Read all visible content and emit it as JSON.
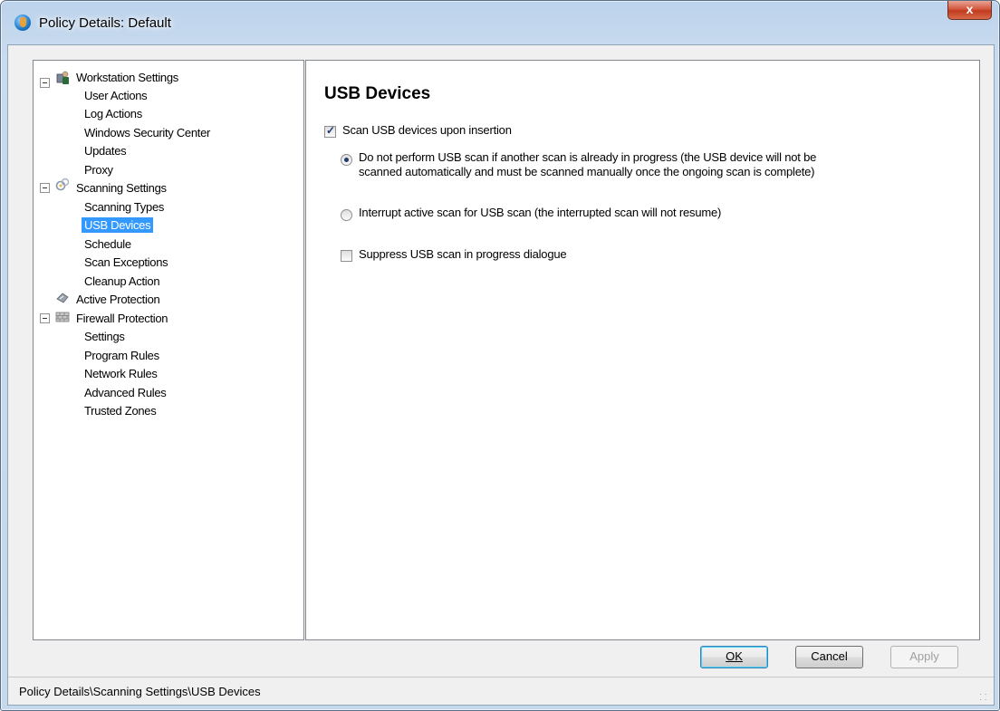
{
  "window": {
    "title": "Policy Details:  Default",
    "close_label": "x"
  },
  "tree": {
    "groups": [
      {
        "label": "Workstation Settings",
        "icon": "workstation-icon",
        "items": [
          "User Actions",
          "Log Actions",
          "Windows Security Center",
          "Updates",
          "Proxy"
        ]
      },
      {
        "label": "Scanning Settings",
        "icon": "scanning-icon",
        "items": [
          "Scanning Types",
          "USB Devices",
          "Schedule",
          "Scan Exceptions",
          "Cleanup Action"
        ]
      },
      {
        "label": "Active Protection",
        "icon": "active-protection-icon",
        "items": []
      },
      {
        "label": "Firewall Protection",
        "icon": "firewall-icon",
        "items": [
          "Settings",
          "Program Rules",
          "Network Rules",
          "Advanced Rules",
          "Trusted Zones"
        ]
      }
    ],
    "selected": "USB Devices"
  },
  "content": {
    "heading": "USB Devices",
    "scan_checkbox": {
      "label": "Scan USB devices upon insertion",
      "checked": true
    },
    "radio_options": [
      {
        "line1": "Do not perform USB scan if another scan is already in progress (the USB device will not be",
        "line2": "scanned automatically and must be scanned manually once the ongoing scan is complete)",
        "checked": true
      },
      {
        "line1": "Interrupt active scan for USB scan (the interrupted scan will not resume)",
        "checked": false
      }
    ],
    "suppress_checkbox": {
      "label": "Suppress USB scan in progress dialogue",
      "checked": false
    }
  },
  "buttons": {
    "ok": "OK",
    "cancel": "Cancel",
    "apply": "Apply"
  },
  "status": {
    "path": "Policy Details\\Scanning Settings\\USB Devices"
  }
}
